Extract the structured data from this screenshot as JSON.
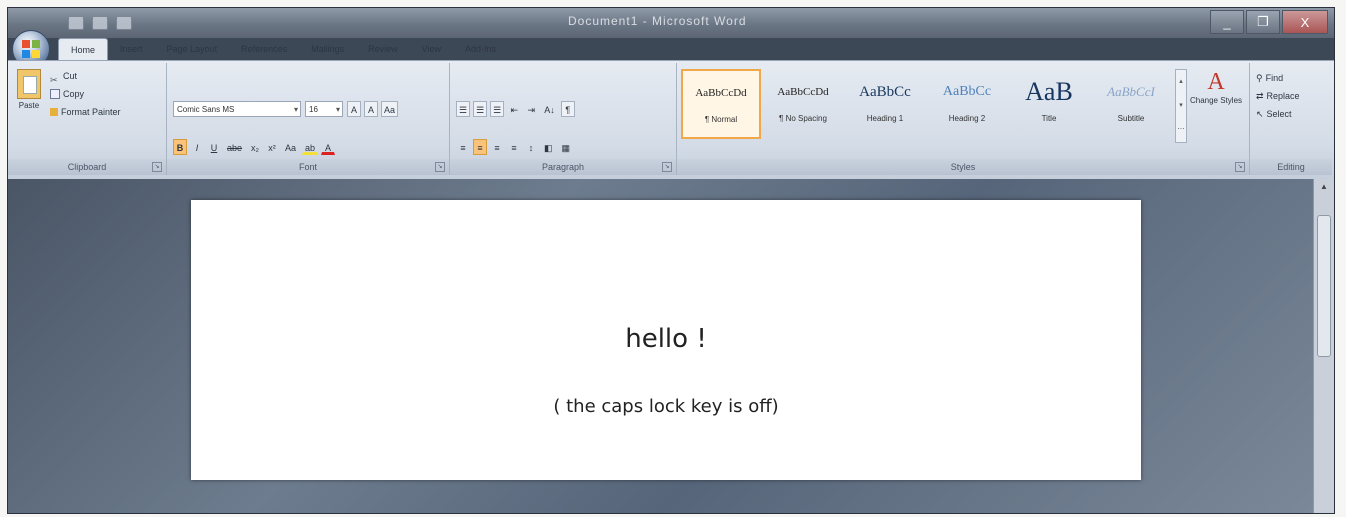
{
  "window": {
    "title": "Document1 - Microsoft Word",
    "controls": {
      "minimize": "_",
      "maximize": "❐",
      "close": "X"
    }
  },
  "tabs": [
    "Home",
    "Insert",
    "Page Layout",
    "References",
    "Mailings",
    "Review",
    "View",
    "Add-Ins"
  ],
  "clipboard": {
    "paste_label": "Paste",
    "cut_label": "Cut",
    "copy_label": "Copy",
    "format_painter_label": "Format Painter",
    "group_label": "Clipboard"
  },
  "font": {
    "font_name": "Comic Sans MS",
    "font_size": "16",
    "grow_label": "A",
    "shrink_label": "A",
    "clear_label": "Aa",
    "bold_label": "B",
    "italic_label": "I",
    "underline_label": "U",
    "strike_label": "abe",
    "subscript_label": "x₂",
    "superscript_label": "x²",
    "change_case_label": "Aa",
    "highlight_label": "ab",
    "font_color_label": "A",
    "group_label": "Font"
  },
  "paragraph": {
    "bullets": "☰",
    "numbering": "☰",
    "multilevel": "☰",
    "decrease_indent": "⇤",
    "increase_indent": "⇥",
    "sort": "A↓",
    "show_marks": "¶",
    "align_left": "≡",
    "center": "≡",
    "align_right": "≡",
    "justify": "≡",
    "line_spacing": "↕",
    "shading": "◧",
    "borders": "▦",
    "group_label": "Paragraph"
  },
  "styles": {
    "items": [
      {
        "sample": "AaBbCcDd",
        "name": "¶ Normal",
        "selected": true
      },
      {
        "sample": "AaBbCcDd",
        "name": "¶ No Spacing",
        "selected": false
      },
      {
        "sample": "AaBbCc",
        "name": "Heading 1",
        "selected": false
      },
      {
        "sample": "AaBbCc",
        "name": "Heading 2",
        "selected": false
      },
      {
        "sample": "AaB",
        "name": "Title",
        "selected": false
      },
      {
        "sample": "AaBbCcI",
        "name": "Subtitle",
        "selected": false
      }
    ],
    "change_styles_label": "Change Styles",
    "group_label": "Styles"
  },
  "editing": {
    "find_label": "Find",
    "replace_label": "Replace",
    "select_label": "Select",
    "group_label": "Editing"
  },
  "document": {
    "line1": "hello !",
    "line2": "( the caps lock key is off)"
  },
  "colors": {
    "accent_orange": "#f0a84a",
    "title_blue": "#17365d"
  }
}
